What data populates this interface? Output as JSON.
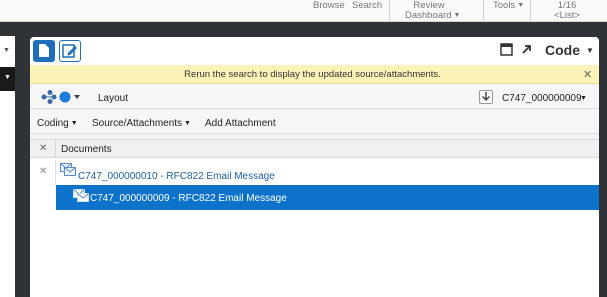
{
  "topnav": {
    "browse": "Browse",
    "search": "Search",
    "review_line1": "Review",
    "review_line2": "Dashboard",
    "tools": "Tools",
    "pager_line1": "1/16",
    "pager_line2": "<List>"
  },
  "panel": {
    "code_label": "Code",
    "notice_text": "Rerun the search to display the updated source/attachments.",
    "layout_label": "Layout",
    "current_doc": "C747_000000009"
  },
  "menu": {
    "coding": "Coding",
    "source_attachments": "Source/Attachments",
    "add_attachment": "Add Attachment"
  },
  "grid": {
    "column_header": "Documents",
    "rows": [
      {
        "label": "C747_000000010 - RFC822 Email Message",
        "selected": false
      },
      {
        "label": "C747_000000009 - RFC822 Email Message",
        "selected": true
      }
    ]
  },
  "colors": {
    "accent": "#1e6fb8",
    "selected_row": "#0d72c9",
    "notice_bg": "#fbf3b7",
    "frame": "#2f3338"
  },
  "icons": {
    "layout_tools": "node-graph-icon",
    "layout_color": "blue-circle-icon",
    "download": "download-icon",
    "email": "email-icon"
  }
}
